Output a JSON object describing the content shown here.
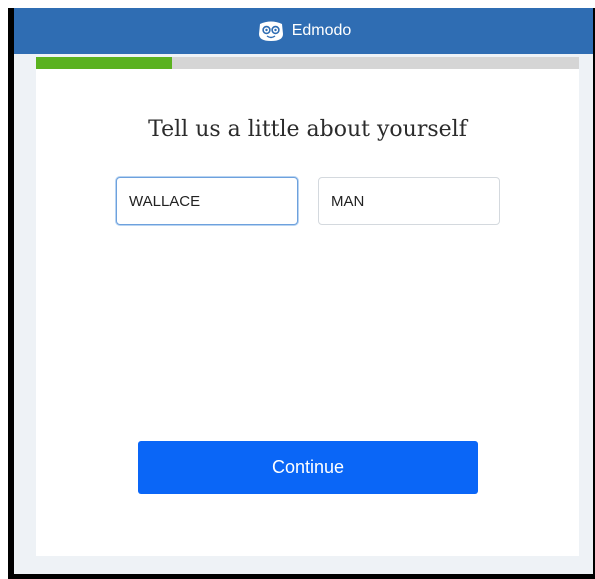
{
  "header": {
    "brand_name": "Edmodo",
    "logo_icon": "edmodo-owl-logo-icon",
    "background_color": "#2f6db3"
  },
  "progress": {
    "fraction": 0.25,
    "fill_color": "#5ab21f",
    "track_color": "#d5d5d5"
  },
  "form": {
    "title": "Tell us a little about yourself",
    "first_name_value": "WALLACE",
    "last_name_value": "MAN",
    "continue_label": "Continue",
    "button_color": "#0a66f7"
  }
}
